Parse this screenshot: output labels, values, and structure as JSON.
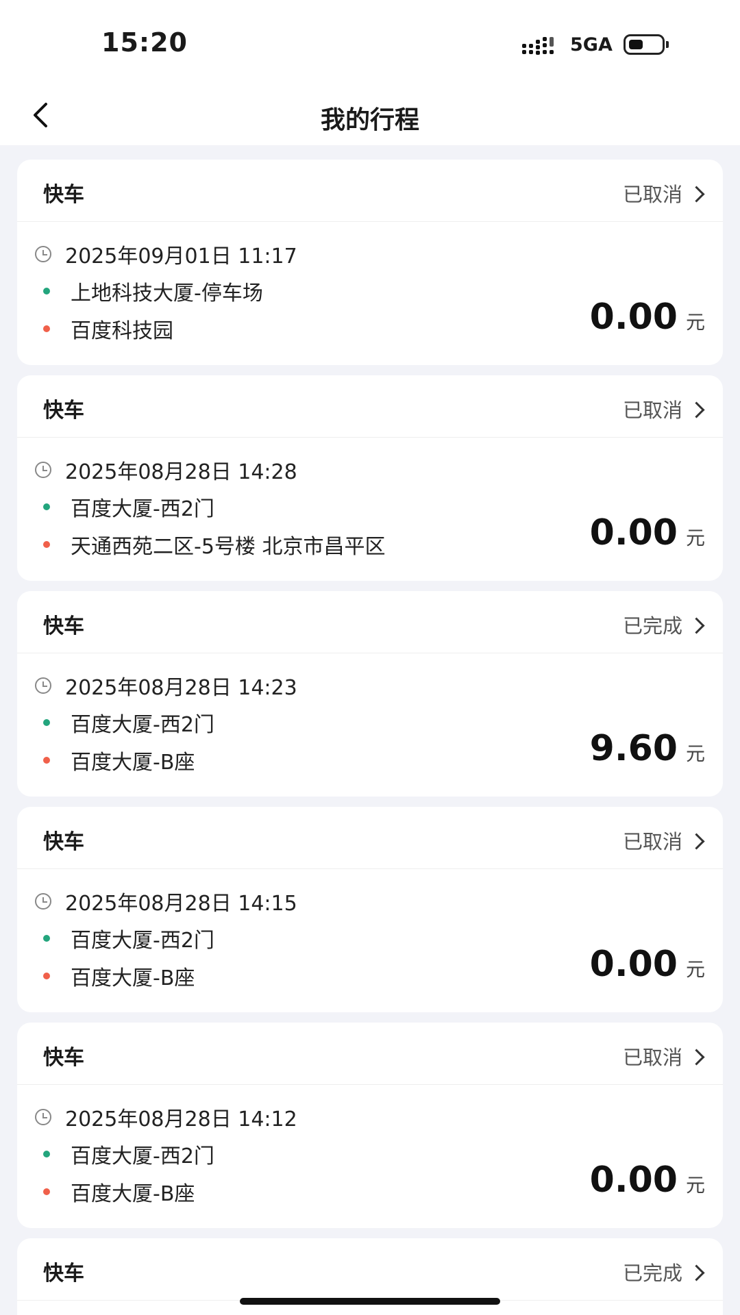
{
  "status_bar": {
    "time": "15:20",
    "network": "5GA"
  },
  "header": {
    "title": "我的行程"
  },
  "trips": [
    {
      "type": "快车",
      "status": "已取消",
      "datetime": "2025年09月01日 11:17",
      "from": "上地科技大厦-停车场",
      "to": "百度科技园",
      "price": "0.00",
      "unit": "元"
    },
    {
      "type": "快车",
      "status": "已取消",
      "datetime": "2025年08月28日 14:28",
      "from": "百度大厦-西2门",
      "to": "天通西苑二区-5号楼 北京市昌平区",
      "price": "0.00",
      "unit": "元"
    },
    {
      "type": "快车",
      "status": "已完成",
      "datetime": "2025年08月28日 14:23",
      "from": "百度大厦-西2门",
      "to": "百度大厦-B座",
      "price": "9.60",
      "unit": "元"
    },
    {
      "type": "快车",
      "status": "已取消",
      "datetime": "2025年08月28日 14:15",
      "from": "百度大厦-西2门",
      "to": "百度大厦-B座",
      "price": "0.00",
      "unit": "元"
    },
    {
      "type": "快车",
      "status": "已取消",
      "datetime": "2025年08月28日 14:12",
      "from": "百度大厦-西2门",
      "to": "百度大厦-B座",
      "price": "0.00",
      "unit": "元"
    },
    {
      "type": "快车",
      "status": "已完成"
    }
  ],
  "colors": {
    "start_dot": "#23a57d",
    "end_dot": "#f0604a",
    "background": "#f2f3f8"
  }
}
